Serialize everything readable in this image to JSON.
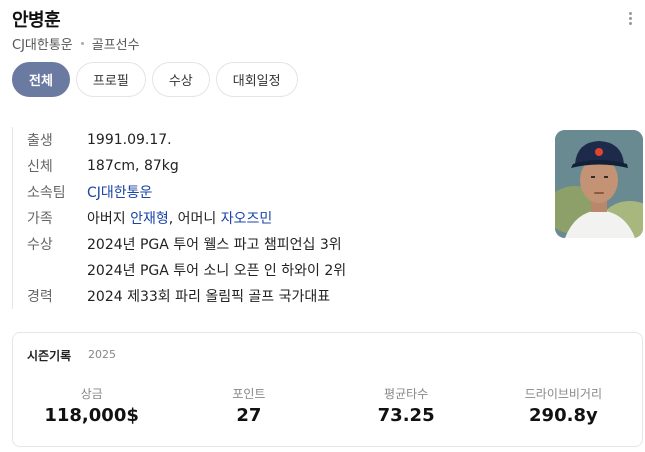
{
  "header": {
    "name": "안병훈",
    "team": "CJ대한통운",
    "occupation": "골프선수"
  },
  "tabs": [
    {
      "label": "전체",
      "active": true
    },
    {
      "label": "프로필",
      "active": false
    },
    {
      "label": "수상",
      "active": false
    },
    {
      "label": "대회일정",
      "active": false
    }
  ],
  "profile": {
    "birth_label": "출생",
    "birth_value": "1991.09.17.",
    "body_label": "신체",
    "body_value": "187cm, 87kg",
    "team_label": "소속팀",
    "team_value": "CJ대한통운",
    "family_label": "가족",
    "family_prefix1": "아버지 ",
    "family_father": "안재형",
    "family_sep": ", 어머니 ",
    "family_mother": "자오즈민",
    "awards_label": "수상",
    "awards": [
      "2024년 PGA 투어 웰스 파고 챔피언십 3위",
      "2024년 PGA 투어 소니 오픈 인 하와이 2위"
    ],
    "career_label": "경력",
    "career_value": "2024 제33회 파리 올림픽 골프 국가대표"
  },
  "season": {
    "title": "시즌기록",
    "year": "2025",
    "stats": [
      {
        "label": "상금",
        "value": "118,000$"
      },
      {
        "label": "포인트",
        "value": "27"
      },
      {
        "label": "평균타수",
        "value": "73.25"
      },
      {
        "label": "드라이브비거리",
        "value": "290.8y"
      }
    ]
  },
  "colors": {
    "accent": "#6b7aa1",
    "link": "#1a46a8"
  }
}
